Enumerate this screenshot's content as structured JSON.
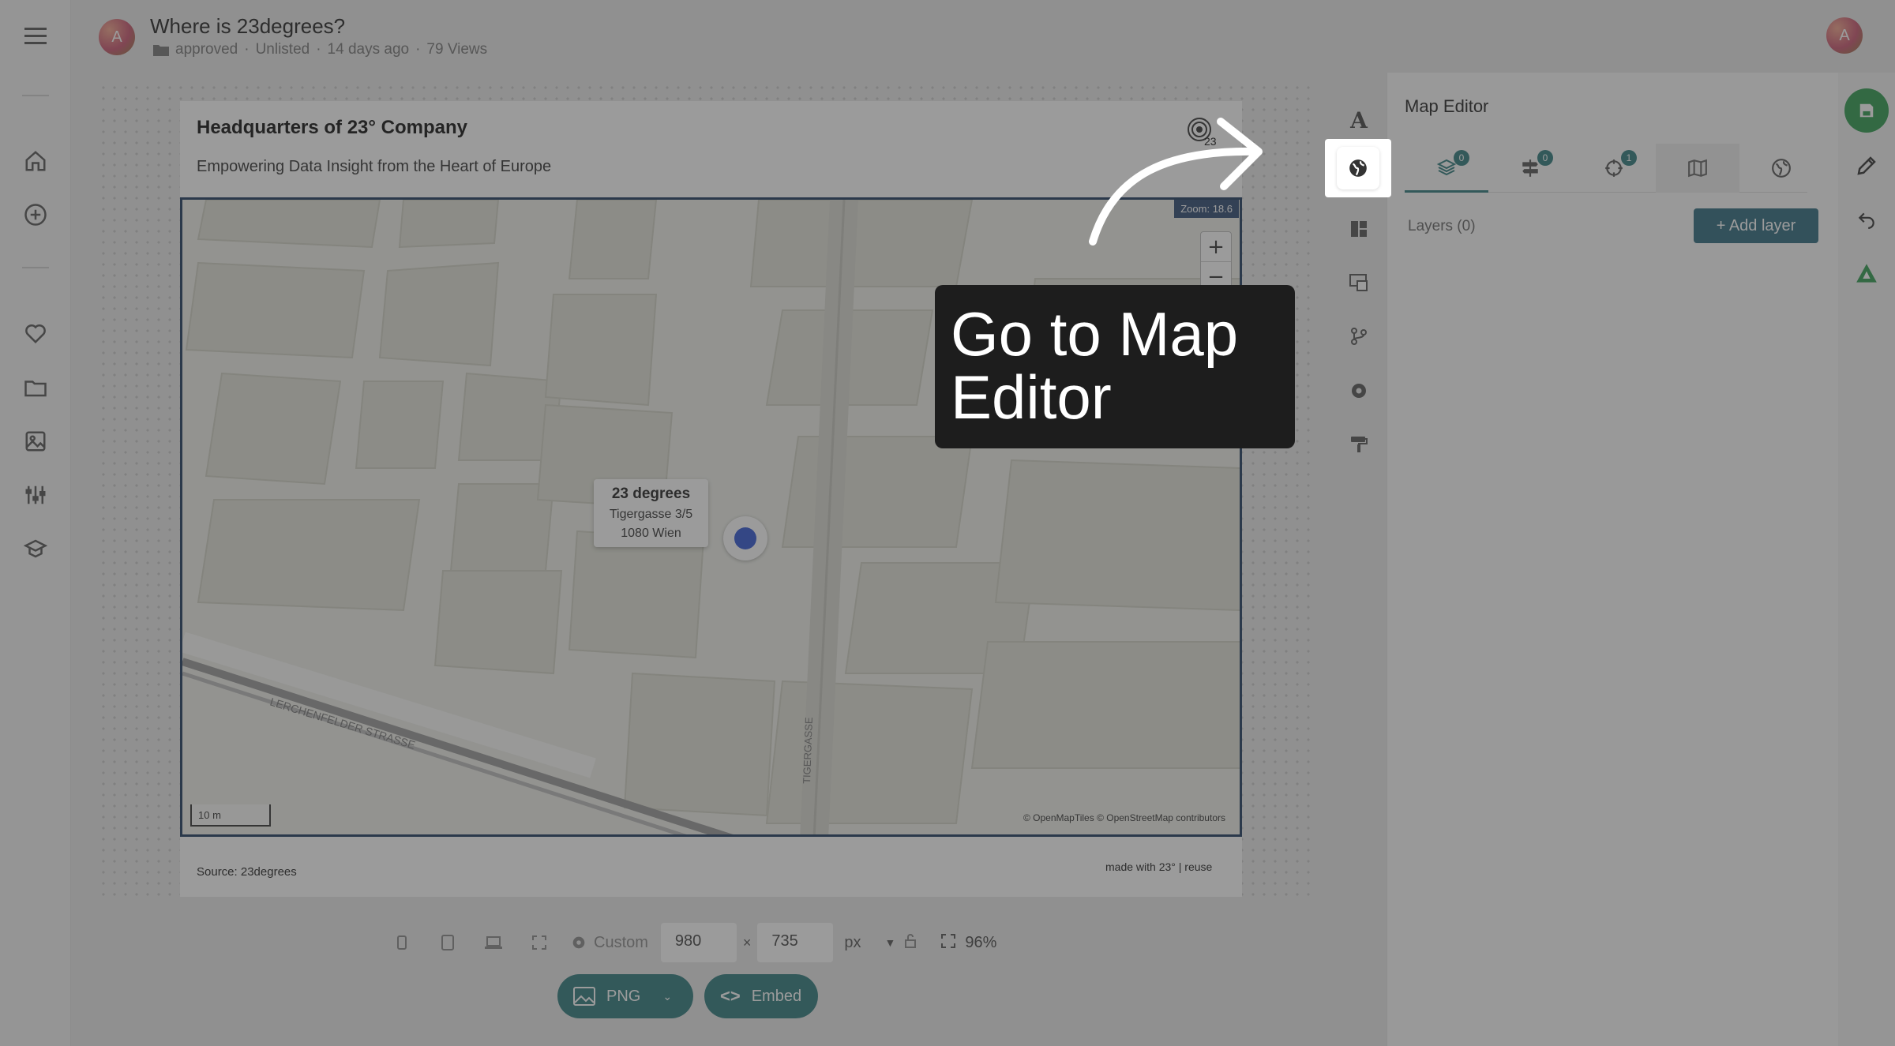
{
  "header": {
    "avatar_letter": "A",
    "title": "Where is 23degrees?",
    "folder": "approved",
    "visibility": "Unlisted",
    "age": "14 days ago",
    "views": "79 Views",
    "user_avatar_letter": "A"
  },
  "left_nav": [
    "menu-icon",
    "home-icon",
    "add-icon",
    "heart-icon",
    "folder-icon",
    "image-icon",
    "sliders-icon",
    "school-icon"
  ],
  "chart": {
    "title": "Headquarters of 23° Company",
    "subtitle": "Empowering Data Insight from the Heart of Europe",
    "source": "Source: 23degrees",
    "made_with": "made with 23° | reuse",
    "logo_text": "23"
  },
  "map": {
    "zoom_label": "Zoom: 18.6",
    "popup": {
      "name": "23 degrees",
      "street": "Tigergasse 3/5",
      "city": "1080 Wien"
    },
    "scale": "10 m",
    "attribution": "© OpenMapTiles © OpenStreetMap contributors",
    "street_1": "LERCHENFELDER STRASSE",
    "street_2": "TIGERGASSE"
  },
  "size_bar": {
    "preset": "Custom",
    "width": "980",
    "times": "×",
    "height": "735",
    "unit": "px",
    "zoom": "96%"
  },
  "export": {
    "png": "PNG",
    "embed": "Embed"
  },
  "editor": {
    "title": "Map Editor",
    "tabs": [
      {
        "icon": "layers-icon",
        "badge": "0"
      },
      {
        "icon": "signpost-icon",
        "badge": "0"
      },
      {
        "icon": "crosshair-icon",
        "badge": "1"
      },
      {
        "icon": "map-icon",
        "badge": ""
      },
      {
        "icon": "globe-icon",
        "badge": ""
      }
    ],
    "layers_label": "Layers (0)",
    "add_layer": "+ Add layer"
  },
  "tooltip": {
    "text": "Go to Map Editor"
  },
  "colors": {
    "accent": "#2e7a7c",
    "marker": "#3056d3",
    "map_border": "#1e3a5f",
    "save": "#2e9a4e"
  }
}
